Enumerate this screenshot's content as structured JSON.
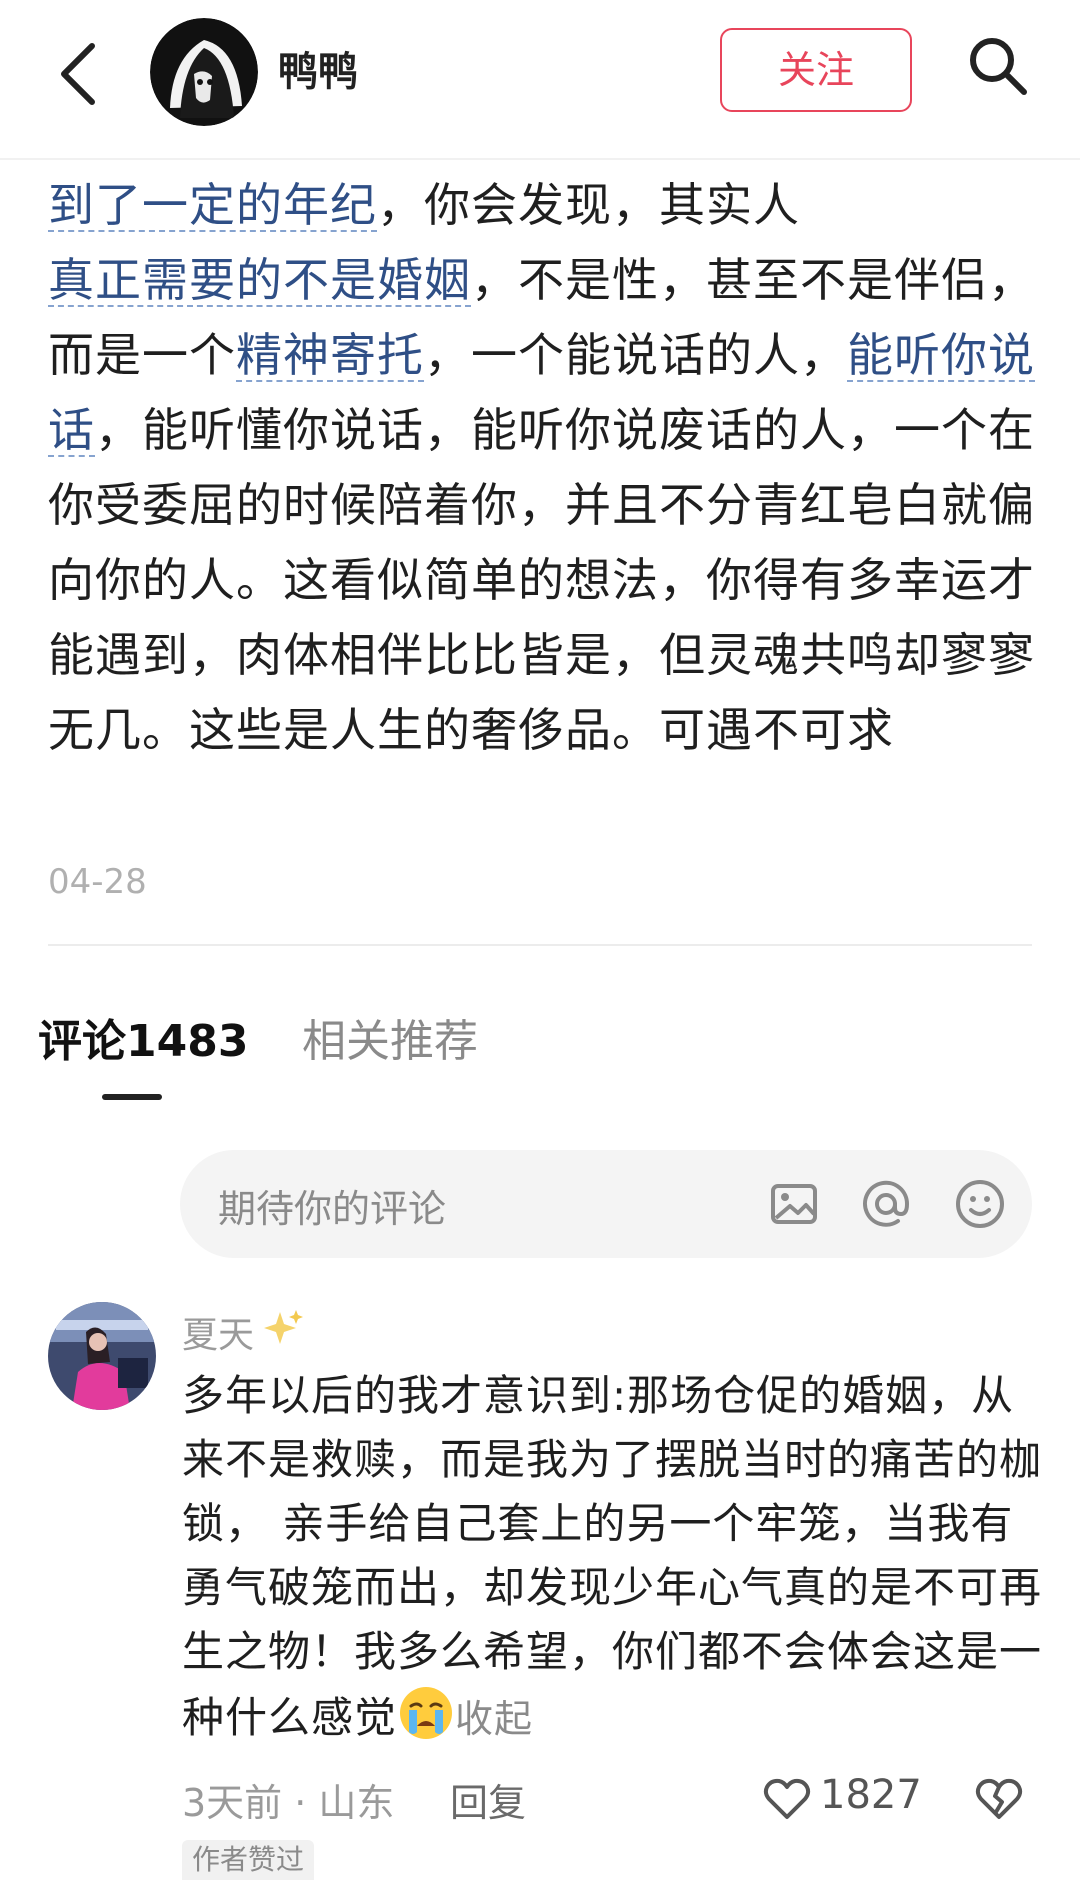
{
  "header": {
    "author_name": "鸭鸭",
    "follow_label": "关注"
  },
  "post": {
    "segments": [
      {
        "text": "到了一定的年纪",
        "keyword": true
      },
      {
        "text": "，你会发现，其实人",
        "keyword": false
      },
      {
        "text": "真正需要的不是婚姻",
        "keyword": true
      },
      {
        "text": "，不是性，甚至不是伴侣，而是一个",
        "keyword": false
      },
      {
        "text": "精神寄托",
        "keyword": true
      },
      {
        "text": "，一个能说话的人，",
        "keyword": false
      },
      {
        "text": "能听你说话",
        "keyword": true
      },
      {
        "text": "，能听懂你说话，能听你说废话的人，一个在你受委屈的时候陪着你，并且不分青红皂白就偏向你的人。这看似简单的想法，你得有多幸运才能遇到，肉体相伴比比皆是，但灵魂共鸣却寥寥无几。这些是人生的奢侈品。可遇不可求",
        "keyword": false
      }
    ],
    "date": "04-28"
  },
  "tabs": {
    "comments_label": "评论1483",
    "related_label": "相关推荐"
  },
  "comment_input": {
    "placeholder": "期待你的评论"
  },
  "comment": {
    "username": "夏天",
    "text": "多年以后的我才意识到:那场仓促的婚姻，从来不是救赎，而是我为了摆脱当时的痛苦的枷锁， 亲手给自己套上的另一个牢笼，当我有勇气破笼而出，却发现少年心气真的是不可再生之物！我多么希望，你们都不会体会这是一种什么感觉",
    "collapse_label": "收起",
    "meta": "3天前 · 山东",
    "reply_label": "回复",
    "like_count": "1827",
    "author_liked_label": "作者赞过"
  },
  "colors": {
    "accent": "#e8455b",
    "keyword": "#2f4f86"
  },
  "icons": [
    "back-arrow-icon",
    "search-icon",
    "image-icon",
    "at-icon",
    "emoji-icon",
    "sparkle-icon",
    "crying-emoji-icon",
    "heart-icon",
    "broken-heart-icon"
  ]
}
